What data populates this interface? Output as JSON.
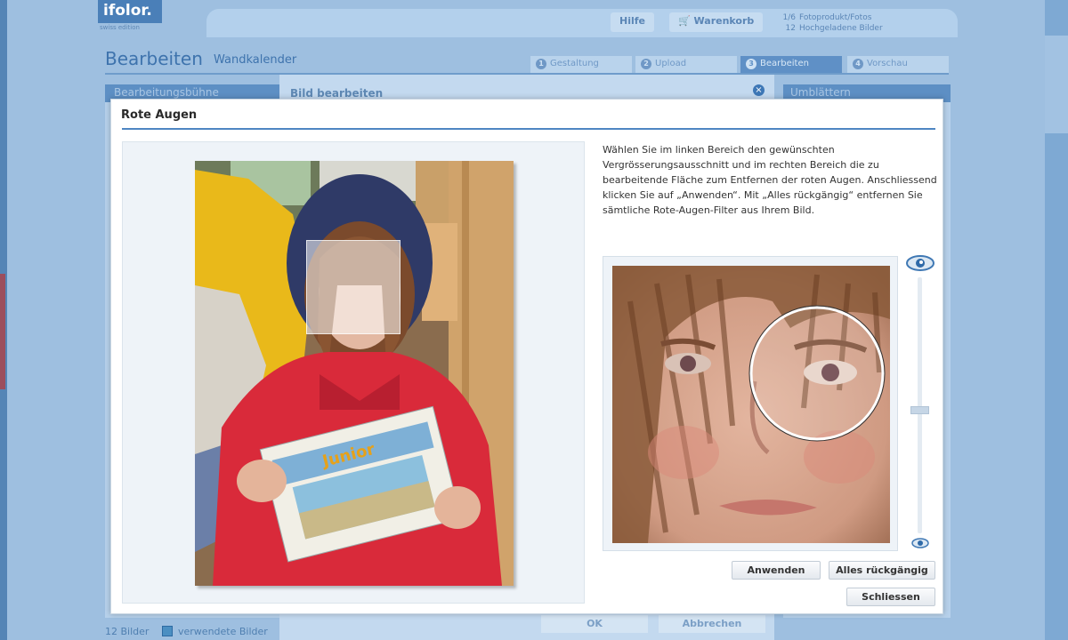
{
  "app": {
    "logo": "ifolor.",
    "logo_tagline": "swiss edition",
    "header_buttons": {
      "help": "Hilfe",
      "cart": "Warenkorb"
    },
    "stats": [
      {
        "value": "1/6",
        "label": "Fotoprodukt/Fotos"
      },
      {
        "value": "12",
        "label": "Hochgeladene Bilder"
      }
    ],
    "title": "Bearbeiten",
    "subtitle": "Wandkalender",
    "steps": [
      {
        "num": "1",
        "label": "Gestaltung",
        "active": false
      },
      {
        "num": "2",
        "label": "Upload",
        "active": false
      },
      {
        "num": "3",
        "label": "Bearbeiten",
        "active": true
      },
      {
        "num": "4",
        "label": "Vorschau",
        "active": false
      }
    ],
    "left_panel_title": "Bearbeitungsbühne",
    "right_panel_title": "Umblättern",
    "background_dialog": {
      "title": "Bild bearbeiten",
      "ok_label": "OK",
      "cancel_label": "Abbrechen"
    },
    "status": {
      "count": "12 Bilder",
      "legend": "verwendete Bilder"
    }
  },
  "dialog": {
    "title": "Rote Augen",
    "instructions": "Wählen Sie im linken Bereich den gewünschten Vergrösserungsausschnitt und im rechten Bereich die zu bearbeitende Fläche zum Entfernen der roten Augen. Anschliessend klicken Sie auf „Anwenden“. Mit „Alles rückgängig“ entfernen Sie sämtliche Rote-Augen-Filter aus Ihrem Bild.",
    "buttons": {
      "apply": "Anwenden",
      "undo_all": "Alles rückgängig",
      "close": "Schliessen"
    },
    "zoom_level": 0.55,
    "icons": {
      "zoom_in": "eye-large-icon",
      "zoom_out": "eye-small-icon",
      "close": "close-icon"
    },
    "colors": {
      "accent": "#4e86c2",
      "jacket": "#d92a3a"
    }
  }
}
